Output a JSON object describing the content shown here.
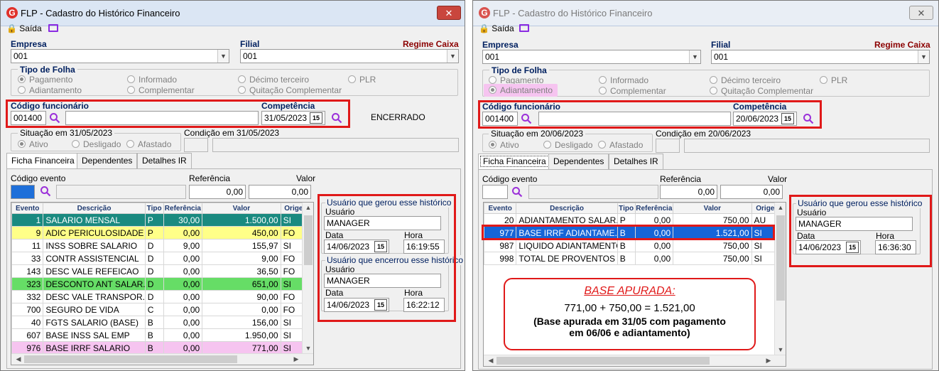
{
  "left": {
    "title": "FLP - Cadastro do Histórico Financeiro",
    "toolbar": {
      "exit_label": "Saída"
    },
    "empresa": {
      "label": "Empresa",
      "value": "001"
    },
    "filial": {
      "label": "Filial",
      "value": "001"
    },
    "regime": "Regime Caixa",
    "tipo_folha": {
      "label": "Tipo de Folha",
      "options": [
        "Pagamento",
        "Informado",
        "Décimo terceiro",
        "PLR",
        "Adiantamento",
        "Complementar",
        "Quitação Complementar"
      ],
      "selected": "Pagamento"
    },
    "codigo_funcionario": {
      "label": "Código funcionário",
      "value": "001400",
      "name": ""
    },
    "competencia": {
      "label": "Competência",
      "value": "31/05/2023"
    },
    "status": "ENCERRADO",
    "situacao": {
      "label": "Situação em  31/05/2023",
      "options": [
        "Ativo",
        "Desligado",
        "Afastado"
      ],
      "selected": "Ativo"
    },
    "condicao": {
      "label": "Condição em 31/05/2023"
    },
    "tabs": [
      "Ficha Financeira",
      "Dependentes",
      "Detalhes IR"
    ],
    "evento": {
      "codigo_label": "Código evento",
      "referencia_label": "Referência",
      "valor_label": "Valor",
      "referencia": "0,00",
      "valor": "0,00"
    },
    "grid": {
      "headers": [
        "Evento",
        "Descrição",
        "Tipo",
        "Referência",
        "Valor",
        "Origem"
      ],
      "rows": [
        [
          "1",
          "SALARIO MENSAL",
          "P",
          "30,00",
          "1.500,00",
          "SI"
        ],
        [
          "9",
          "ADIC PERICULOSIDADE",
          "P",
          "0,00",
          "450,00",
          "FO"
        ],
        [
          "11",
          "INSS SOBRE SALARIO",
          "D",
          "9,00",
          "155,97",
          "SI"
        ],
        [
          "33",
          "CONTR ASSISTENCIAL",
          "D",
          "0,00",
          "9,00",
          "FO"
        ],
        [
          "143",
          "DESC VALE REFEICAO",
          "D",
          "0,00",
          "36,50",
          "FO"
        ],
        [
          "323",
          "DESCONTO ANT SALAR...",
          "D",
          "0,00",
          "651,00",
          "SI"
        ],
        [
          "332",
          "DESC VALE TRANSPOR...",
          "D",
          "0,00",
          "90,00",
          "FO"
        ],
        [
          "700",
          "SEGURO DE VIDA",
          "C",
          "0,00",
          "0,00",
          "FO"
        ],
        [
          "40",
          "FGTS SALARIO (BASE)",
          "B",
          "0,00",
          "156,00",
          "SI"
        ],
        [
          "607",
          "BASE INSS SAL EMP",
          "B",
          "0,00",
          "1.950,00",
          "SI"
        ],
        [
          "976",
          "BASE IRRF SALARIO",
          "B",
          "0,00",
          "771,00",
          "SI"
        ]
      ]
    },
    "gerou": {
      "title": "Usuário que gerou esse histórico",
      "user_label": "Usuário",
      "user": "MANAGER",
      "data_label": "Data",
      "data": "14/06/2023",
      "hora_label": "Hora",
      "hora": "16:19:55"
    },
    "encerrou": {
      "title": "Usuário que encerrou esse histórico",
      "user_label": "Usuário",
      "user": "MANAGER",
      "data_label": "Data",
      "data": "14/06/2023",
      "hora_label": "Hora",
      "hora": "16:22:12"
    }
  },
  "right": {
    "title": "FLP - Cadastro do Histórico Financeiro",
    "toolbar": {
      "exit_label": "Saída"
    },
    "empresa": {
      "label": "Empresa",
      "value": "001"
    },
    "filial": {
      "label": "Filial",
      "value": "001"
    },
    "regime": "Regime Caixa",
    "tipo_folha": {
      "label": "Tipo de Folha",
      "options": [
        "Pagamento",
        "Informado",
        "Décimo terceiro",
        "PLR",
        "Adiantamento",
        "Complementar",
        "Quitação Complementar"
      ],
      "selected": "Adiantamento"
    },
    "codigo_funcionario": {
      "label": "Código funcionário",
      "value": "001400",
      "name": ""
    },
    "competencia": {
      "label": "Competência",
      "value": "20/06/2023"
    },
    "situacao": {
      "label": "Situação em  20/06/2023",
      "options": [
        "Ativo",
        "Desligado",
        "Afastado"
      ],
      "selected": "Ativo"
    },
    "condicao": {
      "label": "Condição em 20/06/2023"
    },
    "tabs": [
      "Ficha Financeira",
      "Dependentes",
      "Detalhes IR"
    ],
    "evento": {
      "codigo_label": "Código evento",
      "referencia_label": "Referência",
      "valor_label": "Valor",
      "referencia": "0,00",
      "valor": "0,00"
    },
    "grid": {
      "headers": [
        "Evento",
        "Descrição",
        "Tipo",
        "Referência",
        "Valor",
        "Origem"
      ],
      "rows": [
        [
          "20",
          "ADIANTAMENTO SALAR...",
          "P",
          "0,00",
          "750,00",
          "AU"
        ],
        [
          "977",
          "BASE IRRF ADIANTAME...",
          "B",
          "0,00",
          "1.521,00",
          "SI"
        ],
        [
          "987",
          "LIQUIDO ADIANTAMENTO",
          "B",
          "0,00",
          "750,00",
          "SI"
        ],
        [
          "998",
          "TOTAL DE PROVENTOS",
          "B",
          "0,00",
          "750,00",
          "SI"
        ]
      ]
    },
    "gerou": {
      "title": "Usuário que gerou esse histórico",
      "user_label": "Usuário",
      "user": "MANAGER",
      "data_label": "Data",
      "data": "14/06/2023",
      "hora_label": "Hora",
      "hora": "16:36:30"
    },
    "callout": {
      "heading": "BASE APURADA:",
      "formula": "771,00 + 750,00 = 1.521,00",
      "note_line1": "(Base apurada em 31/05 com pagamento",
      "note_line2": "em 06/06 e adiantamento)"
    }
  },
  "colors": {
    "teal_row": "#1a8a80",
    "yellow_row": "#ffff88",
    "green_row": "#66dd66",
    "pink_row": "#f6c4f0",
    "selected_row": "#1565d8",
    "highlight_red": "#e01919"
  }
}
